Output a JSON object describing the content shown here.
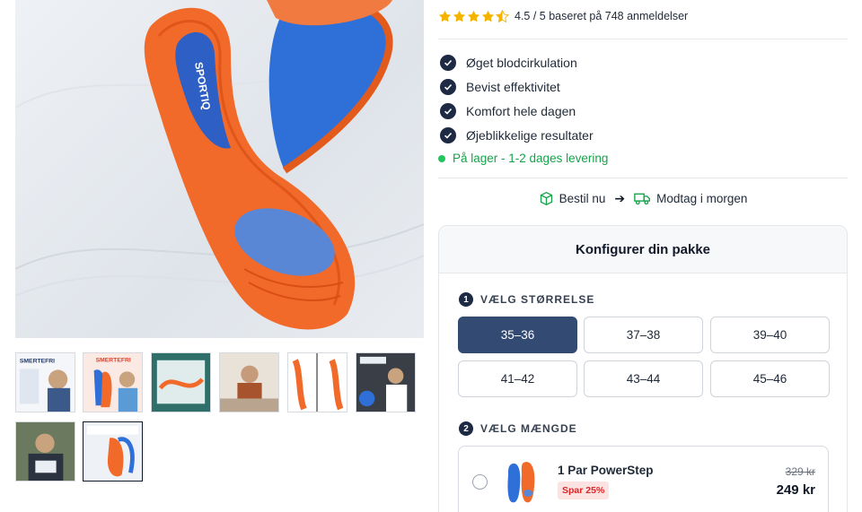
{
  "gallery": {
    "main_image": {
      "brand_text": "SPORTIQ"
    },
    "thumbnails": [
      {
        "label": "SMERTEFRI"
      },
      {
        "label": "SMERTEFRI"
      },
      {
        "label": ""
      },
      {
        "label": ""
      },
      {
        "label": ""
      },
      {
        "label": ""
      },
      {
        "label": ""
      },
      {
        "label": ""
      }
    ]
  },
  "rating": {
    "stars": 4.5,
    "text": "4.5 / 5 baseret på 748 anmeldelser",
    "star_color": "#f5b301"
  },
  "features": [
    "Øget blodcirkulation",
    "Bevist effektivitet",
    "Komfort hele dagen",
    "Øjeblikkelige resultater"
  ],
  "stock": {
    "text": "På lager - 1-2 dages levering",
    "color": "#16a34a"
  },
  "delivery": {
    "order_label": "Bestil nu",
    "receive_label": "Modtag i morgen",
    "order_icon": "box-icon",
    "receive_icon": "truck-icon"
  },
  "config": {
    "title": "Konfigurer din pakke",
    "step1": {
      "num": "1",
      "label": "VÆLG STØRRELSE"
    },
    "sizes": [
      "35–36",
      "37–38",
      "39–40",
      "41–42",
      "43–44",
      "45–46"
    ],
    "selected_size": "35–36",
    "step2": {
      "num": "2",
      "label": "VÆLG MÆNGDE"
    },
    "option": {
      "title": "1 Par PowerStep",
      "badge": "Spar 25%",
      "old_price": "329 kr",
      "price": "249 kr"
    }
  },
  "colors": {
    "accent": "#334a73",
    "navy": "#1e2a44",
    "insole_orange": "#f26a2a",
    "insole_blue": "#2f6fd8"
  }
}
